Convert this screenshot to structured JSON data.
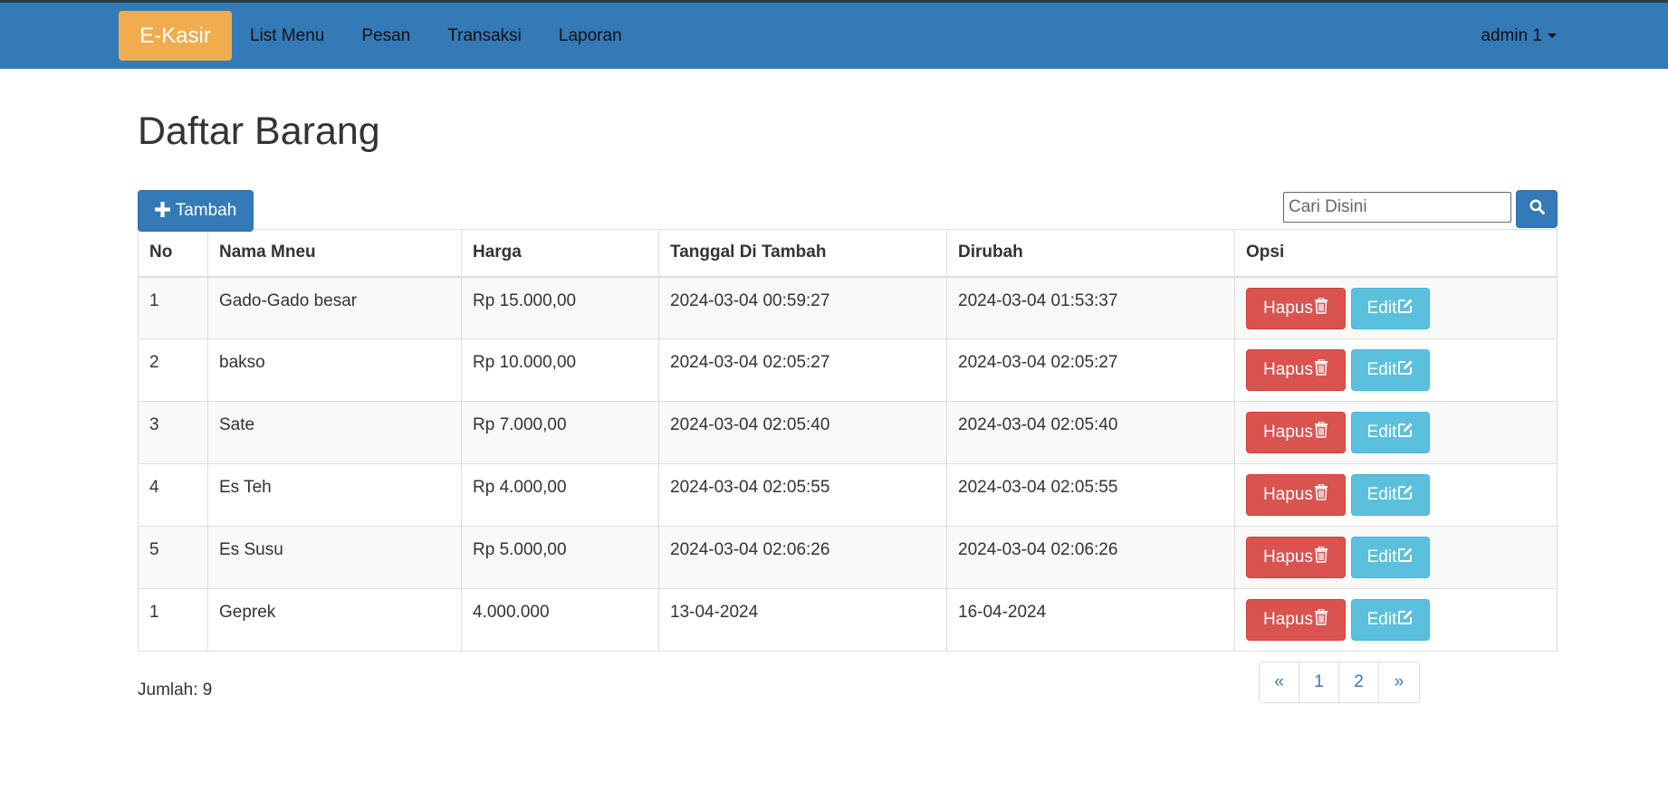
{
  "app": {
    "brand": "E-Kasir",
    "nav": [
      "List Menu",
      "Pesan",
      "Transaksi",
      "Laporan"
    ],
    "user": "admin 1"
  },
  "page": {
    "title": "Daftar Barang",
    "add_label": "Tambah",
    "search_placeholder": "Cari Disini"
  },
  "table": {
    "headers": [
      "No",
      "Nama Mneu",
      "Harga",
      "Tanggal Di Tambah",
      "Dirubah",
      "Opsi"
    ],
    "rows": [
      {
        "no": "1",
        "nama": "Gado-Gado besar",
        "harga": "Rp 15.000,00",
        "tanggal": "2024-03-04 00:59:27",
        "dirubah": "2024-03-04 01:53:37"
      },
      {
        "no": "2",
        "nama": "bakso",
        "harga": "Rp 10.000,00",
        "tanggal": "2024-03-04 02:05:27",
        "dirubah": "2024-03-04 02:05:27"
      },
      {
        "no": "3",
        "nama": "Sate",
        "harga": "Rp 7.000,00",
        "tanggal": "2024-03-04 02:05:40",
        "dirubah": "2024-03-04 02:05:40"
      },
      {
        "no": "4",
        "nama": "Es Teh",
        "harga": "Rp 4.000,00",
        "tanggal": "2024-03-04 02:05:55",
        "dirubah": "2024-03-04 02:05:55"
      },
      {
        "no": "5",
        "nama": "Es Susu",
        "harga": "Rp 5.000,00",
        "tanggal": "2024-03-04 02:06:26",
        "dirubah": "2024-03-04 02:06:26"
      },
      {
        "no": "1",
        "nama": "Geprek",
        "harga": "4.000.000",
        "tanggal": "13-04-2024",
        "dirubah": "16-04-2024"
      }
    ],
    "hapus_label": "Hapus",
    "edit_label": "Edit"
  },
  "footer": {
    "jumlah": "Jumlah: 9"
  },
  "pagination": [
    "«",
    "1",
    "2",
    "»"
  ],
  "colors": {
    "navbar": "#337ab7",
    "brand": "#f0ad4e",
    "danger": "#d9534f",
    "info": "#5bc0de",
    "primary": "#337ab7"
  },
  "icons": {
    "add": "plus-icon",
    "search": "search-icon",
    "hapus": "trash-icon",
    "edit": "edit-icon",
    "user": "caret-down-icon"
  }
}
